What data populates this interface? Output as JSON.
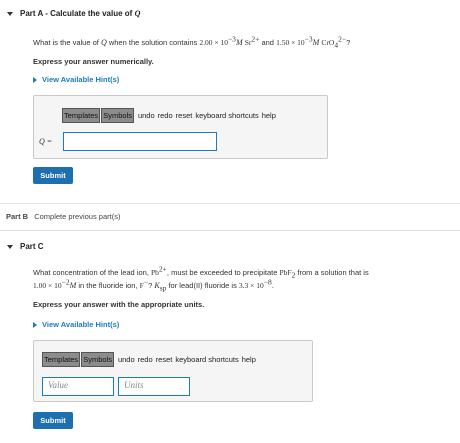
{
  "partA": {
    "header": "Part A - Calculate the value of",
    "header_var": "Q",
    "question_prefix": "What is the value of",
    "question_var": "Q",
    "question_mid": "when the solution contains",
    "conc1": "2.00 × 10",
    "conc1_exp": "−3",
    "conc1_unit": "M",
    "ion1": "Sr",
    "ion1_charge": "2+",
    "and": "and",
    "conc2": "1.50 × 10",
    "conc2_exp": "−3",
    "conc2_unit": "M",
    "ion2": "CrO",
    "ion2_sub": "4",
    "ion2_charge": "2−",
    "question_end": "?",
    "express": "Express your answer numerically.",
    "hint": "View Available Hint(s)",
    "input_label": "Q =",
    "input_value": "",
    "submit": "Submit"
  },
  "toolbar": {
    "templates": "Templates",
    "symbols": "Symbols",
    "undo": "undo",
    "redo": "redo",
    "reset": "reset",
    "shortcuts": "keyboard shortcuts",
    "help": "help"
  },
  "partB": {
    "label": "Part B",
    "status": "Complete previous part(s)"
  },
  "partC": {
    "header": "Part C",
    "line1_prefix": "What concentration of the lead ion,",
    "ion": "Pb",
    "ion_charge": "2+",
    "line1_mid": ", must be exceeded to precipitate",
    "salt": "PbF",
    "salt_sub": "2",
    "line1_end": "from a solution that is",
    "line2_conc": "1.00 × 10",
    "line2_exp": "−2",
    "line2_unit": "M",
    "line2_mid": "in the fluoride ion,",
    "fluoride": "F",
    "fluoride_charge": "−",
    "line2_q": "?",
    "ksp": "K",
    "ksp_sub": "sp",
    "line2_for": "for lead(II) fluoride is",
    "ksp_val": "3.3 × 10",
    "ksp_exp": "−8",
    "line2_end": ".",
    "express": "Express your answer with the appropriate units.",
    "hint": "View Available Hint(s)",
    "value_placeholder": "Value",
    "units_placeholder": "Units",
    "submit": "Submit"
  }
}
